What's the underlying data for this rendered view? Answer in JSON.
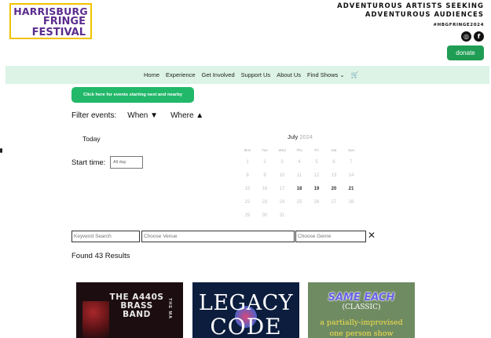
{
  "header": {
    "logo": {
      "line1": "HARRISBURG",
      "line2": "FRINGE",
      "line3": "FESTIVAL"
    },
    "tagline": [
      "ADVENTUROUS ARTISTS SEEKING",
      "ADVENTUROUS AUDIENCES"
    ],
    "hashtag": "#HBGFRINGE2024",
    "social": [
      {
        "icon": "instagram-icon",
        "glyph": "◎"
      },
      {
        "icon": "facebook-icon",
        "glyph": "f"
      }
    ],
    "donate_label": "donate"
  },
  "nav": {
    "items": [
      "Home",
      "Experience",
      "Get Involved",
      "Support Us",
      "About Us"
    ],
    "active": "Find Shows",
    "active_chevron": "⌄",
    "cart_icon": "shopping-cart-icon",
    "cart_glyph": "🛒"
  },
  "cta_label": "Click here for events starting next and nearby",
  "filter": {
    "label": "Filter events:",
    "when": "When ▼",
    "where": "Where ▲"
  },
  "date_panel": {
    "today_label": "Today",
    "start_time_label": "Start time:",
    "start_time_value": "All day"
  },
  "calendar": {
    "month": "July",
    "year": "2024",
    "weekdays": [
      "Mon",
      "Tue",
      "Wed",
      "Thu",
      "Fri",
      "Sat",
      "Sun"
    ],
    "weeks": [
      [
        "1",
        "2",
        "3",
        "4",
        "5",
        "6",
        "7"
      ],
      [
        "8",
        "9",
        "10",
        "11",
        "12",
        "13",
        "14"
      ],
      [
        "15",
        "16",
        "17",
        "18",
        "19",
        "20",
        "21"
      ],
      [
        "22",
        "23",
        "24",
        "25",
        "26",
        "27",
        "28"
      ],
      [
        "29",
        "30",
        "31",
        "",
        "",
        "",
        ""
      ]
    ],
    "highlighted_days": [
      "18",
      "19",
      "20",
      "21"
    ]
  },
  "search": {
    "keyword_placeholder": "Keyword Search",
    "venue_placeholder": "Choose Venue",
    "genre_placeholder": "Choose Genre",
    "clear_glyph": "✕"
  },
  "results_label": "Found 43 Results",
  "cards": [
    {
      "title": "THE A440S BRASS BAND",
      "side_text": "THE MA"
    },
    {
      "title": "LEGACY",
      "subtitle": "CODE"
    },
    {
      "title": "SAME EACH",
      "classic": "(CLASSIC)",
      "sub1": "a partially-improvised",
      "sub2": "one person show"
    }
  ]
}
